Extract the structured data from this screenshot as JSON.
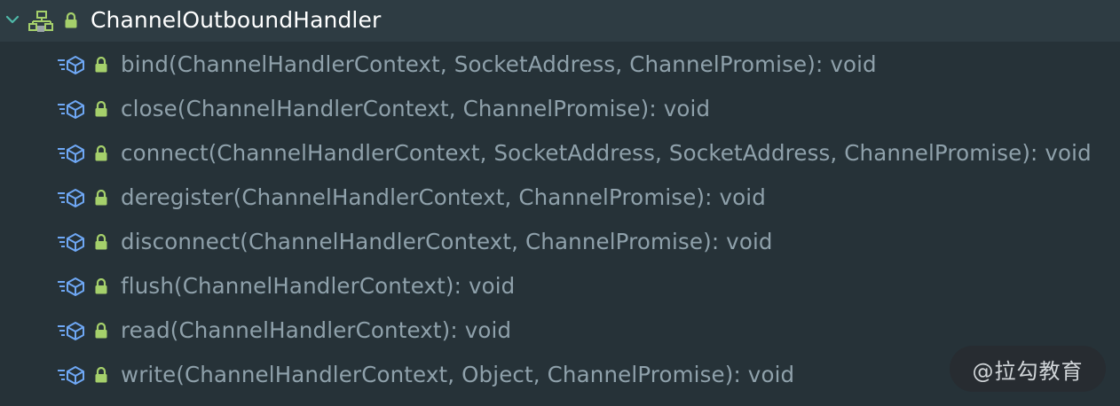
{
  "structure_panel": {
    "root": {
      "label": "ChannelOutboundHandler",
      "icon": "interface-icon",
      "visibility": "public",
      "expanded": true
    },
    "methods": [
      {
        "label": "bind(ChannelHandlerContext, SocketAddress, ChannelPromise): void"
      },
      {
        "label": "close(ChannelHandlerContext, ChannelPromise): void"
      },
      {
        "label": "connect(ChannelHandlerContext, SocketAddress, SocketAddress, ChannelPromise): void"
      },
      {
        "label": "deregister(ChannelHandlerContext, ChannelPromise): void"
      },
      {
        "label": "disconnect(ChannelHandlerContext, ChannelPromise): void"
      },
      {
        "label": "flush(ChannelHandlerContext): void"
      },
      {
        "label": "read(ChannelHandlerContext): void"
      },
      {
        "label": "write(ChannelHandlerContext, Object, ChannelPromise): void"
      }
    ]
  },
  "watermark": {
    "text": "@拉勾教育"
  },
  "colors": {
    "background": "#263238",
    "root_row_background": "#2e3c43",
    "root_text": "#ffffff",
    "method_text": "#8fa1ab",
    "lock_green": "#a5d06b",
    "method_icon_blue": "#6fa8f5",
    "chevron": "#4fb8a8"
  }
}
